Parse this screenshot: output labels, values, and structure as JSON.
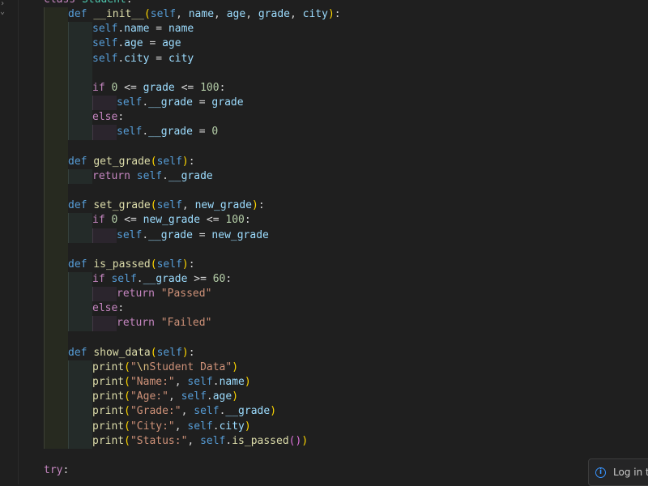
{
  "gutter": {
    "fold_glyph": "› ⌄"
  },
  "code_lines": [
    {
      "indent": 0,
      "tokens": [
        [
          "kw",
          "class "
        ],
        [
          "cls",
          "Student"
        ],
        [
          "op",
          ":"
        ]
      ]
    },
    {
      "indent": 1,
      "tokens": [
        [
          "def",
          "def "
        ],
        [
          "fn",
          "__init__"
        ],
        [
          "br1",
          "("
        ],
        [
          "self",
          "self"
        ],
        [
          "op",
          ", "
        ],
        [
          "prm",
          "name"
        ],
        [
          "op",
          ", "
        ],
        [
          "prm",
          "age"
        ],
        [
          "op",
          ", "
        ],
        [
          "prm",
          "grade"
        ],
        [
          "op",
          ", "
        ],
        [
          "prm",
          "city"
        ],
        [
          "br1",
          ")"
        ],
        [
          "op",
          ":"
        ]
      ]
    },
    {
      "indent": 2,
      "tokens": [
        [
          "self",
          "self"
        ],
        [
          "op",
          "."
        ],
        [
          "prm",
          "name"
        ],
        [
          "op",
          " = "
        ],
        [
          "prm",
          "name"
        ]
      ]
    },
    {
      "indent": 2,
      "tokens": [
        [
          "self",
          "self"
        ],
        [
          "op",
          "."
        ],
        [
          "prm",
          "age"
        ],
        [
          "op",
          " = "
        ],
        [
          "prm",
          "age"
        ]
      ]
    },
    {
      "indent": 2,
      "tokens": [
        [
          "self",
          "self"
        ],
        [
          "op",
          "."
        ],
        [
          "prm",
          "city"
        ],
        [
          "op",
          " = "
        ],
        [
          "prm",
          "city"
        ]
      ]
    },
    {
      "indent": 2,
      "blank": true,
      "tokens": []
    },
    {
      "indent": 2,
      "tokens": [
        [
          "kw",
          "if "
        ],
        [
          "num",
          "0"
        ],
        [
          "op",
          " <= "
        ],
        [
          "prm",
          "grade"
        ],
        [
          "op",
          " <= "
        ],
        [
          "num",
          "100"
        ],
        [
          "op",
          ":"
        ]
      ]
    },
    {
      "indent": 3,
      "tokens": [
        [
          "self",
          "self"
        ],
        [
          "op",
          "."
        ],
        [
          "prm",
          "__grade"
        ],
        [
          "op",
          " = "
        ],
        [
          "prm",
          "grade"
        ]
      ]
    },
    {
      "indent": 2,
      "tokens": [
        [
          "kw",
          "else"
        ],
        [
          "op",
          ":"
        ]
      ]
    },
    {
      "indent": 3,
      "tokens": [
        [
          "self",
          "self"
        ],
        [
          "op",
          "."
        ],
        [
          "prm",
          "__grade"
        ],
        [
          "op",
          " = "
        ],
        [
          "num",
          "0"
        ]
      ]
    },
    {
      "indent": 1,
      "blank": true,
      "tokens": []
    },
    {
      "indent": 1,
      "tokens": [
        [
          "def",
          "def "
        ],
        [
          "fn",
          "get_grade"
        ],
        [
          "br1",
          "("
        ],
        [
          "self",
          "self"
        ],
        [
          "br1",
          ")"
        ],
        [
          "op",
          ":"
        ]
      ]
    },
    {
      "indent": 2,
      "tokens": [
        [
          "kw",
          "return "
        ],
        [
          "self",
          "self"
        ],
        [
          "op",
          "."
        ],
        [
          "prm",
          "__grade"
        ]
      ]
    },
    {
      "indent": 1,
      "blank": true,
      "tokens": []
    },
    {
      "indent": 1,
      "tokens": [
        [
          "def",
          "def "
        ],
        [
          "fn",
          "set_grade"
        ],
        [
          "br1",
          "("
        ],
        [
          "self",
          "self"
        ],
        [
          "op",
          ", "
        ],
        [
          "prm",
          "new_grade"
        ],
        [
          "br1",
          ")"
        ],
        [
          "op",
          ":"
        ]
      ]
    },
    {
      "indent": 2,
      "tokens": [
        [
          "kw",
          "if "
        ],
        [
          "num",
          "0"
        ],
        [
          "op",
          " <= "
        ],
        [
          "prm",
          "new_grade"
        ],
        [
          "op",
          " <= "
        ],
        [
          "num",
          "100"
        ],
        [
          "op",
          ":"
        ]
      ]
    },
    {
      "indent": 3,
      "tokens": [
        [
          "self",
          "self"
        ],
        [
          "op",
          "."
        ],
        [
          "prm",
          "__grade"
        ],
        [
          "op",
          " = "
        ],
        [
          "prm",
          "new_grade"
        ]
      ]
    },
    {
      "indent": 1,
      "blank": true,
      "tokens": []
    },
    {
      "indent": 1,
      "tokens": [
        [
          "def",
          "def "
        ],
        [
          "fn",
          "is_passed"
        ],
        [
          "br1",
          "("
        ],
        [
          "self",
          "self"
        ],
        [
          "br1",
          ")"
        ],
        [
          "op",
          ":"
        ]
      ]
    },
    {
      "indent": 2,
      "tokens": [
        [
          "kw",
          "if "
        ],
        [
          "self",
          "self"
        ],
        [
          "op",
          "."
        ],
        [
          "prm",
          "__grade"
        ],
        [
          "op",
          " >= "
        ],
        [
          "num",
          "60"
        ],
        [
          "op",
          ":"
        ]
      ]
    },
    {
      "indent": 3,
      "tokens": [
        [
          "kw",
          "return "
        ],
        [
          "str",
          "\"Passed\""
        ]
      ]
    },
    {
      "indent": 2,
      "tokens": [
        [
          "kw",
          "else"
        ],
        [
          "op",
          ":"
        ]
      ]
    },
    {
      "indent": 3,
      "tokens": [
        [
          "kw",
          "return "
        ],
        [
          "str",
          "\"Failed\""
        ]
      ]
    },
    {
      "indent": 1,
      "blank": true,
      "tokens": []
    },
    {
      "indent": 1,
      "tokens": [
        [
          "def",
          "def "
        ],
        [
          "fn",
          "show_data"
        ],
        [
          "br1",
          "("
        ],
        [
          "self",
          "self"
        ],
        [
          "br1",
          ")"
        ],
        [
          "op",
          ":"
        ]
      ]
    },
    {
      "indent": 2,
      "tokens": [
        [
          "fn",
          "print"
        ],
        [
          "br1",
          "("
        ],
        [
          "str",
          "\""
        ],
        [
          "esc",
          "\\n"
        ],
        [
          "str",
          "Student Data\""
        ],
        [
          "br1",
          ")"
        ]
      ]
    },
    {
      "indent": 2,
      "tokens": [
        [
          "fn",
          "print"
        ],
        [
          "br1",
          "("
        ],
        [
          "str",
          "\"Name:\""
        ],
        [
          "op",
          ", "
        ],
        [
          "self",
          "self"
        ],
        [
          "op",
          "."
        ],
        [
          "prm",
          "name"
        ],
        [
          "br1",
          ")"
        ]
      ]
    },
    {
      "indent": 2,
      "tokens": [
        [
          "fn",
          "print"
        ],
        [
          "br1",
          "("
        ],
        [
          "str",
          "\"Age:\""
        ],
        [
          "op",
          ", "
        ],
        [
          "self",
          "self"
        ],
        [
          "op",
          "."
        ],
        [
          "prm",
          "age"
        ],
        [
          "br1",
          ")"
        ]
      ]
    },
    {
      "indent": 2,
      "tokens": [
        [
          "fn",
          "print"
        ],
        [
          "br1",
          "("
        ],
        [
          "str",
          "\"Grade:\""
        ],
        [
          "op",
          ", "
        ],
        [
          "self",
          "self"
        ],
        [
          "op",
          "."
        ],
        [
          "prm",
          "__grade"
        ],
        [
          "br1",
          ")"
        ]
      ]
    },
    {
      "indent": 2,
      "tokens": [
        [
          "fn",
          "print"
        ],
        [
          "br1",
          "("
        ],
        [
          "str",
          "\"City:\""
        ],
        [
          "op",
          ", "
        ],
        [
          "self",
          "self"
        ],
        [
          "op",
          "."
        ],
        [
          "prm",
          "city"
        ],
        [
          "br1",
          ")"
        ]
      ]
    },
    {
      "indent": 2,
      "tokens": [
        [
          "fn",
          "print"
        ],
        [
          "br1",
          "("
        ],
        [
          "str",
          "\"Status:\""
        ],
        [
          "op",
          ", "
        ],
        [
          "self",
          "self"
        ],
        [
          "op",
          "."
        ],
        [
          "fn",
          "is_passed"
        ],
        [
          "br2",
          "()"
        ],
        [
          "br1",
          ")"
        ]
      ]
    },
    {
      "indent": 0,
      "blank": true,
      "tokens": []
    },
    {
      "indent": 0,
      "tokens": [
        [
          "kw",
          "try"
        ],
        [
          "op",
          ":"
        ]
      ]
    }
  ],
  "toast": {
    "icon": "info-icon",
    "icon_glyph": "i",
    "text": "Log in to"
  },
  "colors": {
    "background": "#1f1f1f",
    "keyword": "#c586c0",
    "function": "#dcdcaa",
    "self": "#569cd6",
    "string": "#ce9178",
    "number": "#b5cea8",
    "accent": "#3794ff"
  }
}
